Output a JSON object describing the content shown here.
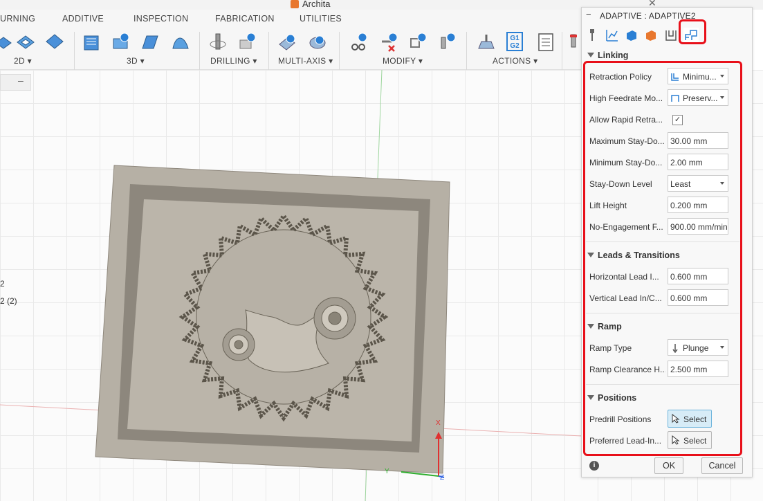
{
  "app": {
    "title": "Archita"
  },
  "toolbar": {
    "tabs": [
      "URNING",
      "ADDITIVE",
      "INSPECTION",
      "FABRICATION",
      "UTILITIES"
    ],
    "groups": [
      "2D ▾",
      "3D ▾",
      "DRILLING ▾",
      "MULTI-AXIS ▾",
      "MODIFY ▾",
      "ACTIONS ▾"
    ],
    "g1g2_line1": "G1",
    "g1g2_line2": "G2"
  },
  "browser": {
    "minus": "–",
    "item1": "2",
    "item2": "2 (2)"
  },
  "dialog": {
    "title": "ADAPTIVE : ADAPTIVE2",
    "sections": {
      "linking": "Linking",
      "leads": "Leads & Transitions",
      "ramp": "Ramp",
      "positions": "Positions"
    },
    "linking": {
      "retraction_policy_label": "Retraction Policy",
      "retraction_policy_value": "Minimu...",
      "high_feedrate_label": "High Feedrate Mo...",
      "high_feedrate_value": "Preserv...",
      "allow_rapid_label": "Allow Rapid Retra...",
      "allow_rapid_checked": true,
      "allow_rapid_mark": "✓",
      "max_stay_label": "Maximum Stay-Do...",
      "max_stay_value": "30.00 mm",
      "min_stay_label": "Minimum Stay-Do...",
      "min_stay_value": "2.00 mm",
      "stay_level_label": "Stay-Down Level",
      "stay_level_value": "Least",
      "lift_height_label": "Lift Height",
      "lift_height_value": "0.200 mm",
      "no_engagement_label": "No-Engagement F...",
      "no_engagement_value": "900.00 mm/min"
    },
    "leads": {
      "horizontal_label": "Horizontal Lead I...",
      "horizontal_value": "0.600 mm",
      "vertical_label": "Vertical Lead In/C...",
      "vertical_value": "0.600 mm"
    },
    "ramp": {
      "type_label": "Ramp Type",
      "type_value": "Plunge",
      "clearance_label": "Ramp Clearance H...",
      "clearance_value": "2.500 mm"
    },
    "positions": {
      "predrill_label": "Predrill Positions",
      "predrill_button": "Select",
      "preferred_label": "Preferred Lead-In...",
      "preferred_button": "Select"
    },
    "buttons": {
      "ok": "OK",
      "cancel": "Cancel",
      "info": "i"
    }
  },
  "axes": {
    "x": "X",
    "y": "Y",
    "z": "Z"
  },
  "colors": {
    "highlight": "#e8101a",
    "accent": "#e8772e",
    "active_select": "#d7ecf7"
  }
}
